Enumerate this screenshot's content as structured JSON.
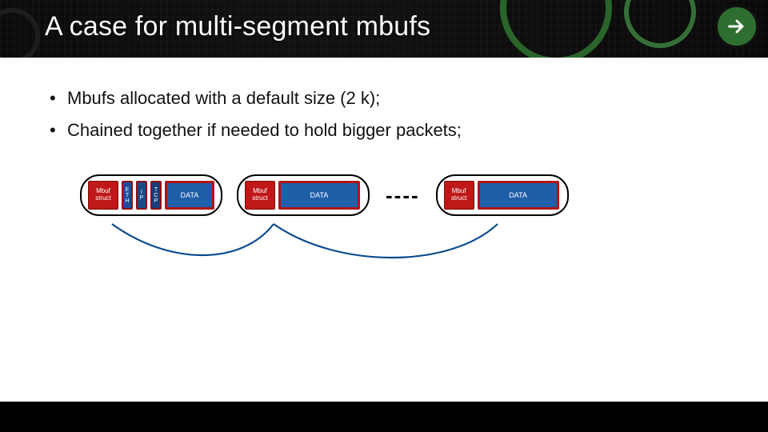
{
  "slide": {
    "title": "A case for multi-segment mbufs",
    "bullets": [
      "Mbufs allocated with a default size (2 k);",
      "Chained together if needed to hold bigger packets;"
    ]
  },
  "mbuf_label_line1": "Mbuf",
  "mbuf_label_line2": "struct",
  "headers": {
    "eth": "E T H",
    "ip": "I P",
    "tcp": "T C P"
  },
  "data_label": "DATA",
  "ellipsis": "----",
  "colors": {
    "accent_red": "#c01818",
    "accent_blue": "#1f5fa8",
    "brand_green": "#2e6e2e"
  }
}
